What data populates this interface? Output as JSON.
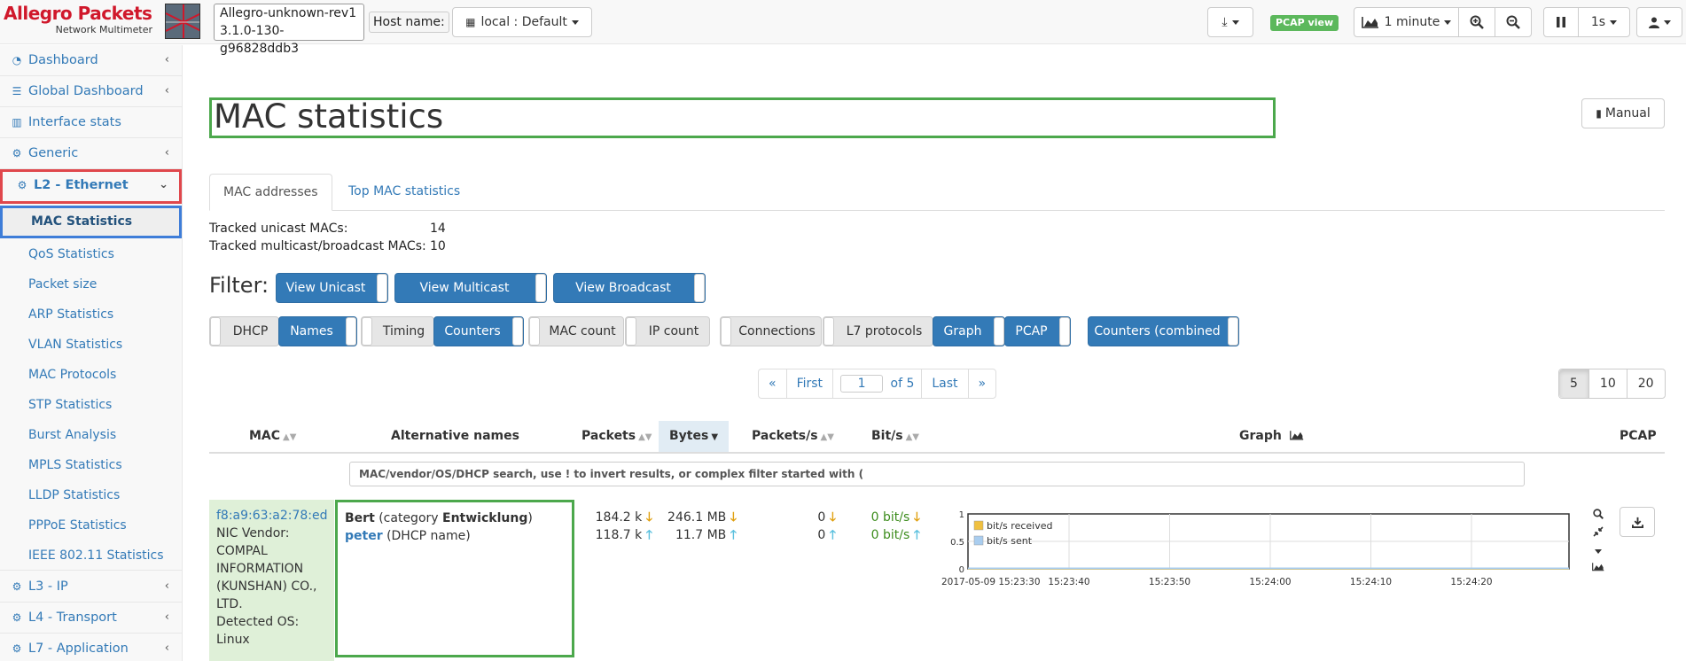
{
  "topbar": {
    "brand": "Allegro Packets",
    "brand_sub": "Network Multimeter",
    "version_line1": "Allegro-unknown-rev1",
    "version_line2": "3.1.0-130-g96828ddb3",
    "host_label": "Host name:",
    "host_value": "local : Default",
    "pcap_badge": "PCAP view",
    "interval": "1 minute",
    "refresh": "1s"
  },
  "sidebar": {
    "top_items": [
      {
        "label": "Dashboard",
        "icon": "dashboard-icon"
      },
      {
        "label": "Global Dashboard",
        "icon": "server-icon"
      },
      {
        "label": "Interface stats",
        "icon": "bar-chart-icon"
      },
      {
        "label": "Generic",
        "icon": "gear-icon"
      }
    ],
    "active_group": "L2 - Ethernet",
    "sub_items": [
      "MAC Statistics",
      "QoS Statistics",
      "Packet size",
      "ARP Statistics",
      "VLAN Statistics",
      "MAC Protocols",
      "STP Statistics",
      "Burst Analysis",
      "MPLS Statistics",
      "LLDP Statistics",
      "PPPoE Statistics",
      "IEEE 802.11 Statistics"
    ],
    "bottom_items": [
      {
        "label": "L3 - IP"
      },
      {
        "label": "L4 - Transport"
      },
      {
        "label": "L7 - Application"
      }
    ]
  },
  "main": {
    "title": "MAC statistics",
    "manual": "Manual",
    "tabs": [
      "MAC addresses",
      "Top MAC statistics"
    ],
    "tracked": [
      {
        "label": "Tracked unicast MACs:",
        "value": "14"
      },
      {
        "label": "Tracked multicast/broadcast MACs:",
        "value": "10"
      }
    ],
    "filter_label": "Filter:",
    "filter_buttons": [
      "View Unicast",
      "View Multicast",
      "View Broadcast"
    ],
    "columns_toggles": [
      {
        "label": "DHCP",
        "on": false
      },
      {
        "label": "Names",
        "on": true
      },
      {
        "label": "Timing",
        "on": false
      },
      {
        "label": "Counters",
        "on": true
      },
      {
        "label": "MAC count",
        "on": false
      },
      {
        "label": "IP count",
        "on": false
      },
      {
        "label": "Connections",
        "on": false
      },
      {
        "label": "L7 protocols",
        "on": false
      },
      {
        "label": "Graph",
        "on": true
      },
      {
        "label": "PCAP",
        "on": true
      },
      {
        "label": "Counters (combined",
        "on": true
      }
    ],
    "pager": {
      "prev": "«",
      "first": "First",
      "page": "1",
      "of": "of 5",
      "last": "Last",
      "next": "»"
    },
    "page_sizes": [
      "5",
      "10",
      "20"
    ],
    "table_headers": {
      "mac": "MAC",
      "alt_names": "Alternative names",
      "packets": "Packets",
      "bytes": "Bytes",
      "packets_s": "Packets/s",
      "bits_s": "Bit/s",
      "graph": "Graph",
      "pcap": "PCAP"
    },
    "search_placeholder": "MAC/vendor/OS/DHCP search, use ! to invert results, or complex filter started with (",
    "row": {
      "mac": "f8:a9:63:a2:78:ed",
      "vendor_label": "NIC Vendor:",
      "vendor": "COMPAL INFORMATION (KUNSHAN) CO., LTD.",
      "os_label": "Detected OS:",
      "os": "Linux",
      "name1": "Bert",
      "name1_cat_pre": "(category ",
      "name1_cat": "Entwicklung",
      "name1_cat_post": ")",
      "name2": "peter",
      "name2_note": "(DHCP name)",
      "packets_rx": "184.2 k",
      "packets_tx": "118.7 k",
      "bytes_rx": "246.1 MB",
      "bytes_tx": "11.7 MB",
      "pps_rx": "0",
      "pps_tx": "0",
      "bps_rx": "0 bit/s",
      "bps_tx": "0 bit/s"
    }
  },
  "chart_data": {
    "type": "line",
    "series": [
      {
        "name": "bit/s received",
        "color": "#f0c040",
        "values": [
          0,
          0,
          0,
          0,
          0,
          0,
          0
        ]
      },
      {
        "name": "bit/s sent",
        "color": "#a9cdef",
        "values": [
          0,
          0,
          0,
          0,
          0,
          0,
          0
        ]
      }
    ],
    "x": [
      "2017-05-09 15:23:30",
      "15:23:40",
      "15:23:50",
      "15:24:00",
      "15:24:10",
      "15:24:20"
    ],
    "y_ticks": [
      "1",
      "0.5",
      "0"
    ],
    "ylim": [
      0,
      1
    ]
  }
}
